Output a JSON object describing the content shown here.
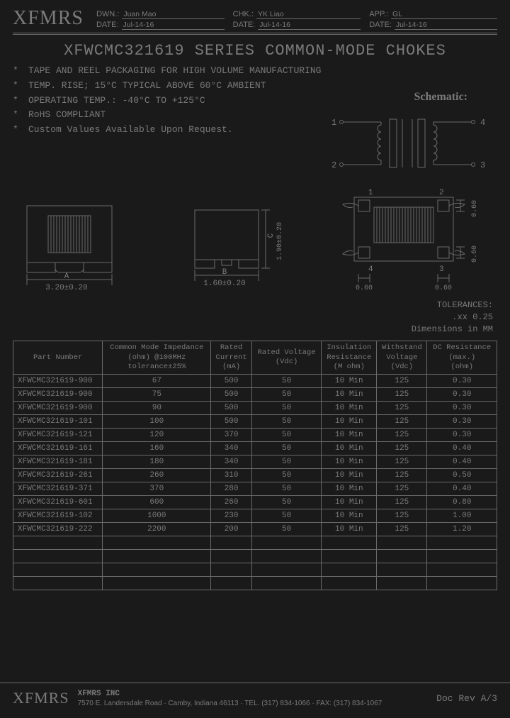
{
  "logo": "XFMRS",
  "header": {
    "dwn_label": "DWN.:",
    "dwn": "Juan Mao",
    "chk_label": "CHK.:",
    "chk": "YK Liao",
    "app_label": "APP.:",
    "app": "GL",
    "date_label": "DATE:",
    "date1": "Jul-14-16",
    "date2": "Jul-14-16",
    "date3": "Jul-14-16"
  },
  "title": "XFWCMC321619 SERIES COMMON-MODE CHOKES",
  "bullets": [
    "TAPE AND REEL PACKAGING FOR HIGH VOLUME MANUFACTURING",
    "TEMP. RISE; 15°C TYPICAL ABOVE 60°C AMBIENT",
    "OPERATING TEMP.: -40°C TO +125°C",
    "RoHS COMPLIANT",
    "Custom Values Available Upon Request."
  ],
  "schematic_label": "Schematic:",
  "schematic": {
    "pin1": "1",
    "pin2": "2",
    "pin3": "3",
    "pin4": "4"
  },
  "dims": {
    "A_label": "A",
    "A": "3.20±0.20",
    "B_label": "B",
    "B": "1.60±0.20",
    "C_label": "C",
    "C": "1.90±0.20",
    "pad_w": "0.60",
    "pad_h_top": "0.60",
    "pad_h_bot": "0.60",
    "pad1": "1",
    "pad2": "2",
    "pad3": "3",
    "pad4": "4"
  },
  "tolerances": {
    "title": "TOLERANCES:",
    "line1": ".xx 0.25",
    "line2": "Dimensions in MM"
  },
  "table": {
    "headers": [
      "Part Number",
      "Common Mode Impedance\n(ohm) @100MHz\ntolerance±25%",
      "Rated\nCurrent\n(mA)",
      "Rated Voltage\n(Vdc)",
      "Insulation\nResistance\n(M ohm)",
      "Withstand\nVoltage\n(Vdc)",
      "DC Resistance\n(max.)\n(ohm)"
    ],
    "rows": [
      [
        "XFWCMC321619-900",
        "67",
        "500",
        "50",
        "10 Min",
        "125",
        "0.30"
      ],
      [
        "XFWCMC321619-900",
        "75",
        "500",
        "50",
        "10 Min",
        "125",
        "0.30"
      ],
      [
        "XFWCMC321619-900",
        "90",
        "500",
        "50",
        "10 Min",
        "125",
        "0.30"
      ],
      [
        "XFWCMC321619-101",
        "100",
        "500",
        "50",
        "10 Min",
        "125",
        "0.30"
      ],
      [
        "XFWCMC321619-121",
        "120",
        "370",
        "50",
        "10 Min",
        "125",
        "0.30"
      ],
      [
        "XFWCMC321619-161",
        "160",
        "340",
        "50",
        "10 Min",
        "125",
        "0.40"
      ],
      [
        "XFWCMC321619-181",
        "180",
        "340",
        "50",
        "10 Min",
        "125",
        "0.40"
      ],
      [
        "XFWCMC321619-261",
        "260",
        "310",
        "50",
        "10 Min",
        "125",
        "0.50"
      ],
      [
        "XFWCMC321619-371",
        "370",
        "280",
        "50",
        "10 Min",
        "125",
        "0.40"
      ],
      [
        "XFWCMC321619-601",
        "600",
        "260",
        "50",
        "10 Min",
        "125",
        "0.80"
      ],
      [
        "XFWCMC321619-102",
        "1000",
        "230",
        "50",
        "10 Min",
        "125",
        "1.00"
      ],
      [
        "XFWCMC321619-222",
        "2200",
        "200",
        "50",
        "10 Min",
        "125",
        "1.20"
      ]
    ],
    "empty_rows": 4
  },
  "footer": {
    "logo": "XFMRS",
    "name": "XFMRS INC",
    "addr": "7570 E. Landersdale Road · Camby, Indiana 46113 · TEL. (317) 834-1066 · FAX: (317) 834-1067",
    "rev": "Doc Rev A/3"
  }
}
